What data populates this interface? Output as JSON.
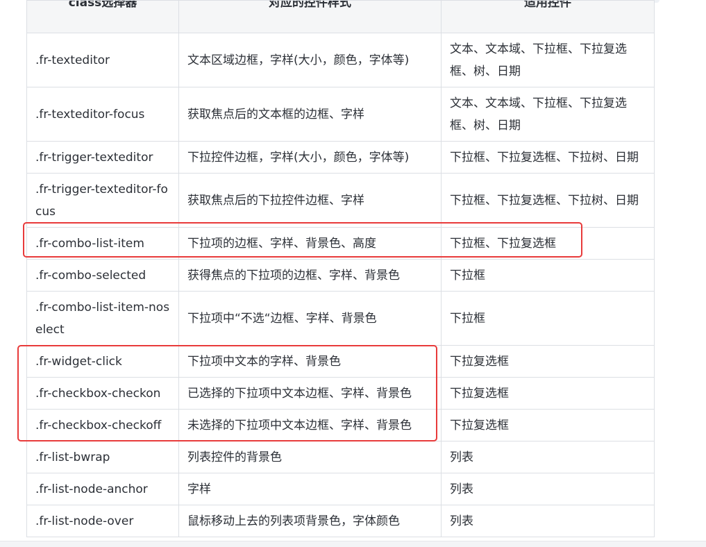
{
  "table": {
    "headers": [
      "class选择器",
      "对应的控件样式",
      "适用控件"
    ],
    "rows": [
      {
        "selector": ".fr-texteditor",
        "style": "文本区域边框，字样(大小，颜色，字体等)",
        "widgets": "文本、文本域、下拉框、下拉复选框、树、日期"
      },
      {
        "selector": ".fr-texteditor-focus",
        "style": "获取焦点后的文本框的边框、字样",
        "widgets": "文本、文本域、下拉框、下拉复选框、树、日期"
      },
      {
        "selector": ".fr-trigger-texteditor",
        "style": "下拉控件边框，字样(大小，颜色，字体等)",
        "widgets": "下拉框、下拉复选框、下拉树、日期"
      },
      {
        "selector": ".fr-trigger-texteditor-focus",
        "style": "获取焦点后的下拉控件边框、字样",
        "widgets": "下拉框、下拉复选框、下拉树、日期"
      },
      {
        "selector": ".fr-combo-list-item",
        "style": "下拉项的边框、字样、背景色、高度",
        "widgets": "下拉框、下拉复选框"
      },
      {
        "selector": ".fr-combo-selected",
        "style": "获得焦点的下拉项的边框、字样、背景色",
        "widgets": "下拉框"
      },
      {
        "selector": ".fr-combo-list-item-noselect",
        "style": "下拉项中“不选“边框、字样、背景色",
        "widgets": "下拉框"
      },
      {
        "selector": ".fr-widget-click",
        "style": "下拉项中文本的字样、背景色",
        "widgets": "下拉复选框"
      },
      {
        "selector": ".fr-checkbox-checkon",
        "style": "已选择的下拉项中文本边框、字样、背景色",
        "widgets": "下拉复选框"
      },
      {
        "selector": ".fr-checkbox-checkoff",
        "style": "未选择的下拉项中文本边框、字样、背景色",
        "widgets": "下拉复选框"
      },
      {
        "selector": ".fr-list-bwrap",
        "style": "列表控件的背景色",
        "widgets": "列表"
      },
      {
        "selector": ".fr-list-node-anchor",
        "style": "字样",
        "widgets": "列表"
      },
      {
        "selector": ".fr-list-node-over",
        "style": "鼠标移动上去的列表项背景色，字体颜色",
        "widgets": "列表"
      }
    ]
  },
  "colors": {
    "highlight_box": "#e83a3a",
    "header_bg": "#f5f6f7",
    "border": "#dcdfe4"
  }
}
